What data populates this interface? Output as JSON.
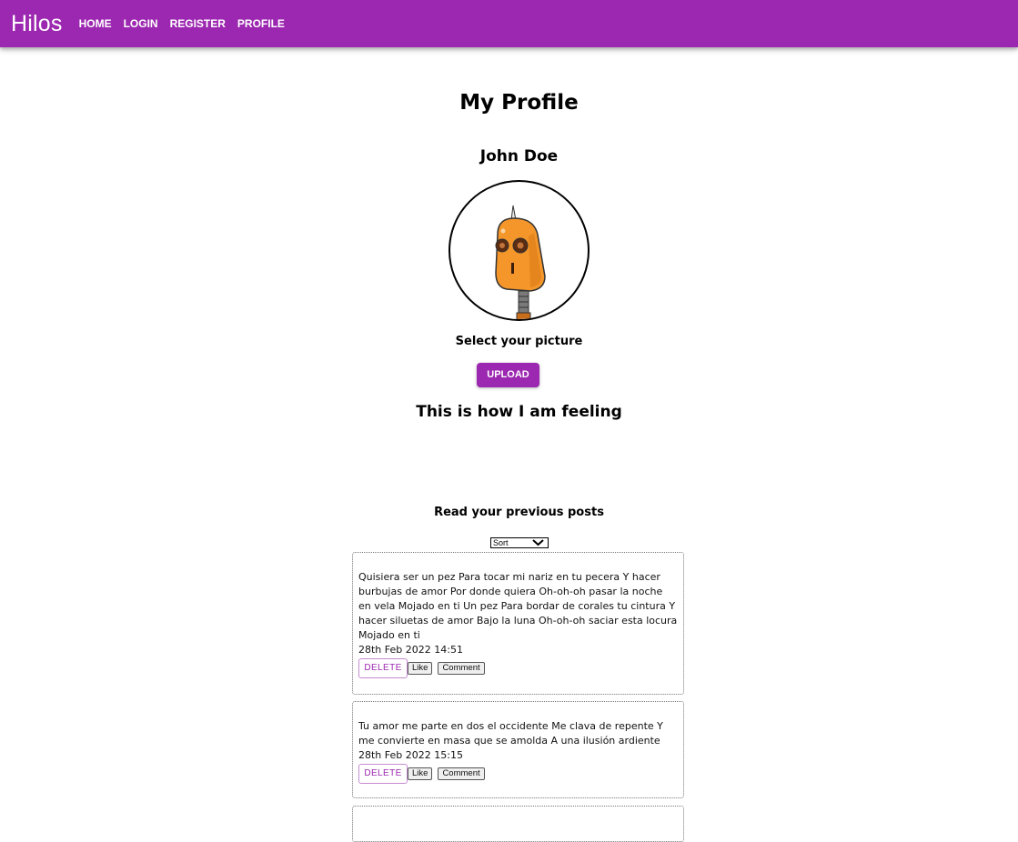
{
  "nav": {
    "brand": "Hilos",
    "items": [
      "HOME",
      "LOGIN",
      "REGISTER",
      "PROFILE"
    ]
  },
  "profile": {
    "title": "My Profile",
    "name": "John Doe",
    "select_label": "Select your picture",
    "upload_label": "UPLOAD",
    "feeling_title": "This is how I am feeling"
  },
  "posts_section": {
    "title": "Read your previous posts",
    "sort_selected": "Sort",
    "posts": [
      {
        "text": "Quisiera ser un pez Para tocar mi nariz en tu pecera Y hacer burbujas de amor Por donde quiera Oh-oh-oh pasar la noche en vela Mojado en ti Un pez Para bordar de corales tu cintura Y hacer siluetas de amor Bajo la luna Oh-oh-oh saciar esta locura Mojado en ti",
        "date": "28th Feb 2022 14:51",
        "delete_label": "DELETE",
        "like_label": "Like",
        "comment_label": "Comment"
      },
      {
        "text": "Tu amor me parte en dos el occidente Me clava de repente Y me convierte en masa que se amolda A una ilusión ardiente",
        "date": "28th Feb 2022 15:15",
        "delete_label": "DELETE",
        "like_label": "Like",
        "comment_label": "Comment"
      }
    ]
  },
  "colors": {
    "primary": "#9c27b0",
    "avatar_orange": "#f4962a"
  },
  "icons": {
    "sort_chevron": "chevron-down-icon",
    "avatar": "robot-avatar"
  }
}
